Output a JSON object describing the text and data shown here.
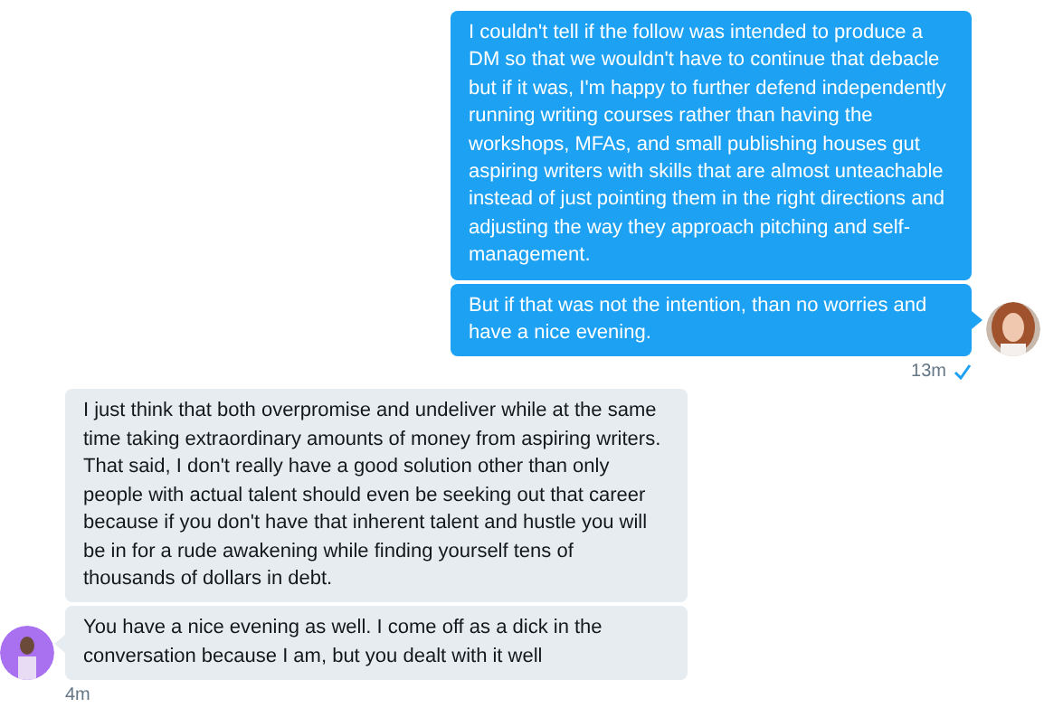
{
  "groups": [
    {
      "kind": "sent",
      "messages": [
        "I couldn't tell if the follow was intended to produce a DM so that we wouldn't have to continue that debacle but if it was, I'm happy to further defend independently running writing courses rather than having the workshops, MFAs, and small publishing houses gut aspiring writers with skills that are almost unteachable instead of just pointing them in the right directions and adjusting the way they approach pitching and self-management.",
        "But if that was not the intention, than no worries and have a nice evening."
      ],
      "time": "13m",
      "read": true
    },
    {
      "kind": "received",
      "messages": [
        "I just think that both overpromise and undeliver while at the same time taking extraordinary amounts of money from aspiring writers. That said, I don't really have a good solution other than only people with actual talent should even be seeking out that career because if you don't have that inherent talent and hustle you will be in for a rude awakening while finding yourself tens of thousands of dollars in debt.",
        "You have a nice evening as well. I come off as a dick in the conversation because I am, but you dealt with it well"
      ],
      "time": "4m"
    }
  ]
}
